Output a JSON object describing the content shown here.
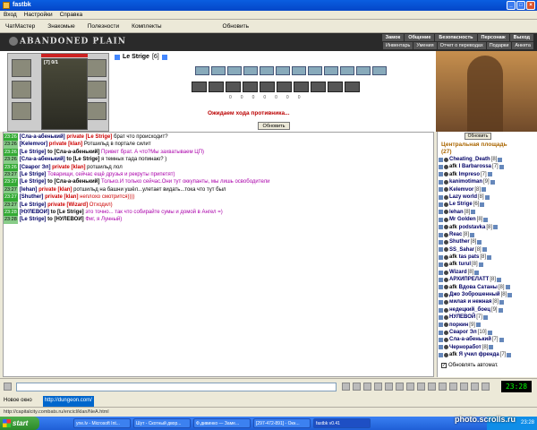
{
  "window": {
    "title": "fastbk"
  },
  "menu": [
    "Вход",
    "Настройки",
    "Справка"
  ],
  "toolbar": [
    "ЧатМастер",
    "Знакомые",
    "Полезности",
    "Комплекты",
    "Обновить"
  ],
  "game_header": {
    "logo": "ABANDONED PLAIN",
    "nav_top": [
      "Замок",
      "Общение",
      "Безопасность",
      "Персонаж",
      "Выход"
    ],
    "nav_bottom": [
      "Инвентарь",
      "Умения",
      "Отчет о переводах",
      "Подарки",
      "Анкета"
    ]
  },
  "player": {
    "level_badge": "[7] 0/1",
    "name": "Le Strige",
    "level": "[6]"
  },
  "battle": {
    "wait_message": "Ожидаем хода противника...",
    "refresh_label": "Обновить",
    "counters": [
      "0",
      "0",
      "0",
      "0",
      "0",
      "0",
      "0"
    ]
  },
  "chat": [
    {
      "time": "23:26",
      "nick": "[Сла-а-абенький]",
      "to": "private [Le Strige]",
      "text": "брат что происходит?",
      "color": "default"
    },
    {
      "time": "23:26",
      "nick": "[Kelemvor]",
      "to": "private [klan]",
      "text": "Ротшильд в портале силит",
      "color": "default"
    },
    {
      "time": "23:26",
      "nick": "[Le Strige]",
      "to": "to [Сла-а-абенький]",
      "text": "Привет брат. А что?Мы захватываем ЦП)",
      "color": "purple"
    },
    {
      "time": "23:26",
      "nick": "[Сла-а-абенький]",
      "to": "to [Le Strige]",
      "text": "я темных тада попинаю? )",
      "color": "default"
    },
    {
      "time": "23:26",
      "nick": "[Сварог Эл]",
      "to": "private [klan]",
      "text": "ротшильд лол",
      "color": "default"
    },
    {
      "time": "23:27",
      "nick": "[Le Strige]",
      "to": "",
      "text": "Товарищи, сейчас ещё друзья и рекруты припетят)",
      "color": "purple"
    },
    {
      "time": "23:27",
      "nick": "[Le Strige]",
      "to": "to [Сла-а-абенький]",
      "text": "Только.И только сейчас.Они тут оккупанты, мы лишь освободители",
      "color": "purple"
    },
    {
      "time": "23:27",
      "nick": "[lehan]",
      "to": "private [klan]",
      "text": "ротшильд на башни ушёл...улетает видать...тока что тут был",
      "color": "default"
    },
    {
      "time": "23:27",
      "nick": "[Shuther]",
      "to": "private [klan]",
      "text": "неплохо смотрится))))",
      "color": "red"
    },
    {
      "time": "23:27",
      "nick": "[Le Strige]",
      "to": "private [Wizard]",
      "text": "Отходил)",
      "color": "red"
    },
    {
      "time": "23:28",
      "nick": "[НУЛЕВОЙ]",
      "to": "to [Le Strige]",
      "text": "это точно... так что собирайте сумы и домой в Ангел =)",
      "color": "purple"
    },
    {
      "time": "23:28",
      "nick": "[Le Strige]",
      "to": "to [НУЛЕВОЙ]",
      "text": "Фиг, я Лунный)",
      "color": "purple"
    }
  ],
  "users_panel": {
    "refresh_label": "Обновить",
    "location": "Центральная площадь",
    "count": "(27)",
    "auto_update_label": "Обновлять автомат.",
    "users": [
      {
        "afk": false,
        "name": "Cheating_Death",
        "level": "[8]"
      },
      {
        "afk": true,
        "name": "I Barbarossa",
        "level": "[7]"
      },
      {
        "afk": true,
        "name": "Impreso",
        "level": "[7]"
      },
      {
        "afk": false,
        "name": "kanimotiman",
        "level": "[9]"
      },
      {
        "afk": false,
        "name": "Kelemvor",
        "level": "[8]"
      },
      {
        "afk": false,
        "name": "Lazy world",
        "level": "[8]"
      },
      {
        "afk": false,
        "name": "Le Strige",
        "level": "[6]"
      },
      {
        "afk": false,
        "name": "lehan",
        "level": "[8]"
      },
      {
        "afk": false,
        "name": "Mr Golden",
        "level": "[8]"
      },
      {
        "afk": true,
        "name": "podstavka",
        "level": "[8]"
      },
      {
        "afk": false,
        "name": "Reac",
        "level": "[8]"
      },
      {
        "afk": false,
        "name": "Shuther",
        "level": "[8]"
      },
      {
        "afk": false,
        "name": "SS_Sahar",
        "level": "[8]"
      },
      {
        "afk": true,
        "name": "tas pats",
        "level": "[8]"
      },
      {
        "afk": true,
        "name": "turul",
        "level": "[8]"
      },
      {
        "afk": false,
        "name": "Wizard",
        "level": "[8]"
      },
      {
        "afk": false,
        "name": "АРХИПРЕЛАТТ",
        "level": "[8]"
      },
      {
        "afk": true,
        "name": "Вдова Сатаны",
        "level": "[8]"
      },
      {
        "afk": false,
        "name": "Джо Зоброшенный",
        "level": "[8]"
      },
      {
        "afk": false,
        "name": "милая и нежная",
        "level": "[8]"
      },
      {
        "afk": false,
        "name": "недецкий_боец",
        "level": "[9]"
      },
      {
        "afk": false,
        "name": "НУЛЕВОЙ",
        "level": "[7]"
      },
      {
        "afk": false,
        "name": "поркин",
        "level": "[9]"
      },
      {
        "afk": false,
        "name": "Сварог Эл",
        "level": "[10]"
      },
      {
        "afk": false,
        "name": "Сла-а-абенький",
        "level": "[7]"
      },
      {
        "afk": false,
        "name": "Черноработ",
        "level": "[8]"
      },
      {
        "afk": true,
        "name": "Я учил френда",
        "level": "[7]"
      }
    ]
  },
  "input": {
    "clock": "23:28"
  },
  "tabs": [
    "Новое окно",
    "http://dungeon.com/"
  ],
  "status_bar": "http://capitalcity.combats.ru/encicl/klan/NeA.html",
  "taskbar": {
    "start": "start",
    "tasks": [
      "yne.lv - Microsoft Int...",
      "Шут - Скотный двор...",
      "Ф.дивинко — Заме...",
      "[297-472-891] - Окн...",
      "fastbk v0.41"
    ],
    "tray_time": "23:28"
  },
  "watermark": "photo.scrolls.ru"
}
